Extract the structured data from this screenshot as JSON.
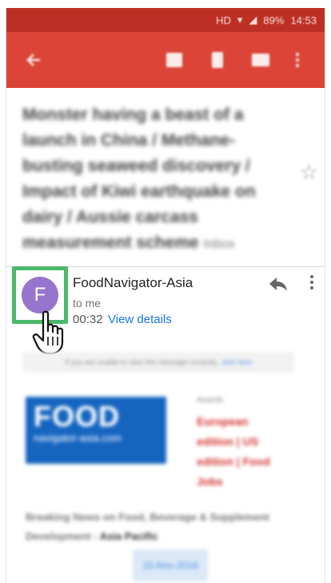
{
  "status_bar": {
    "network": "HD",
    "battery": "89%",
    "time": "14:53"
  },
  "toolbar": {
    "icons": [
      "back-arrow-icon",
      "archive-icon",
      "delete-icon",
      "mail-icon",
      "more-vert-icon"
    ]
  },
  "email": {
    "subject": "Monster having a beast of a launch in China / Methane-busting seaweed discovery / Impact of Kiwi earthquake on dairy / Aussie carcass measurement scheme",
    "subject_tag": "Inbox",
    "sender": {
      "avatar_letter": "F",
      "avatar_color": "#9575cd",
      "name": "FoodNavigator-Asia",
      "to": "to me",
      "time": "00:32",
      "view_details": "View details"
    }
  },
  "body": {
    "notice_text": "If you are unable to view this message correctly,",
    "notice_link": "click here",
    "logo_main": "FOOD",
    "logo_sub": "navigator-asia.com",
    "awards_label": "Awards",
    "awards_lines": [
      "European",
      "edition | US",
      "edition | Food",
      "Jobs"
    ],
    "headline": "Breaking News on Food, Beverage & Supplement Development -",
    "headline_region": "Asia Pacific",
    "date": "15-Nov-2016"
  },
  "highlight_color": "#4cb96a",
  "accent_color": "#db4437"
}
